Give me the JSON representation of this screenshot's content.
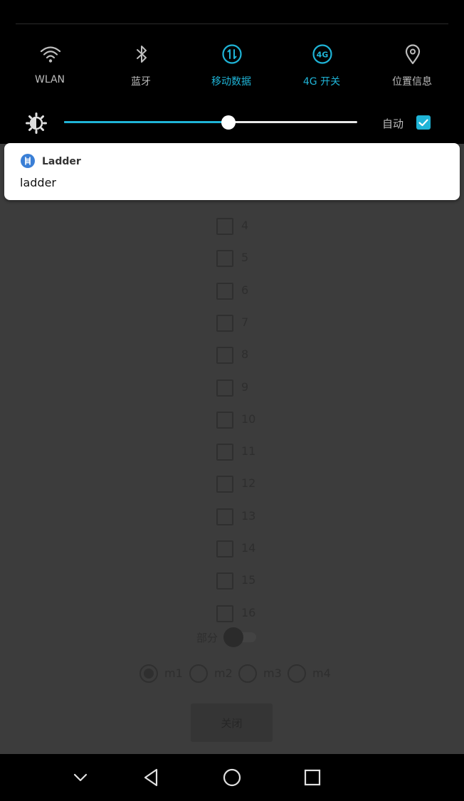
{
  "quick_settings": {
    "tiles": [
      {
        "label": "WLAN",
        "icon": "wifi-icon",
        "active": false
      },
      {
        "label": "蓝牙",
        "icon": "bluetooth-icon",
        "active": false
      },
      {
        "label": "移动数据",
        "icon": "mobile-data-icon",
        "active": true
      },
      {
        "label": "4G 开关",
        "icon": "4g-icon",
        "active": true
      },
      {
        "label": "位置信息",
        "icon": "location-icon",
        "active": false
      }
    ],
    "brightness": {
      "icon": "brightness-icon",
      "level": 0.56,
      "auto_label": "自动",
      "auto_checked": true
    },
    "accent_color": "#1fb4d7"
  },
  "notification": {
    "app_name": "Ladder",
    "text": "ladder",
    "icon": "ladder-app-icon",
    "icon_color": "#3a7fd6"
  },
  "app": {
    "checkbox_labels": [
      "4",
      "5",
      "6",
      "7",
      "8",
      "9",
      "10",
      "11",
      "12",
      "13",
      "14",
      "15",
      "16"
    ],
    "partial_toggle_label": "部分",
    "radio_options": [
      {
        "label": "m1",
        "selected": true
      },
      {
        "label": "m2",
        "selected": false
      },
      {
        "label": "m3",
        "selected": false
      },
      {
        "label": "m4",
        "selected": false
      }
    ],
    "close_button_label": "关闭"
  },
  "nav_bar": {
    "buttons": [
      "collapse-icon",
      "back-icon",
      "home-icon",
      "recents-icon"
    ]
  }
}
